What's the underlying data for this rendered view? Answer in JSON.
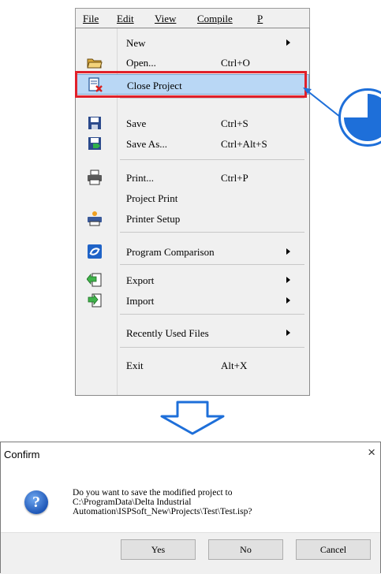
{
  "menubar": {
    "file": "File",
    "edit": "Edit",
    "view": "View",
    "compile": "Compile",
    "p": "P"
  },
  "menu": {
    "items": [
      {
        "label": "New",
        "shortcut": "",
        "submenu": true,
        "icon": ""
      },
      {
        "label": "Open...",
        "shortcut": "Ctrl+O",
        "submenu": false,
        "icon": "open-folder-icon"
      },
      {
        "label": "Close Project",
        "shortcut": "",
        "submenu": false,
        "icon": "close-project-icon"
      },
      {
        "label": "Save",
        "shortcut": "Ctrl+S",
        "submenu": false,
        "icon": "save-icon"
      },
      {
        "label": "Save As...",
        "shortcut": "Ctrl+Alt+S",
        "submenu": false,
        "icon": "save-as-icon"
      },
      {
        "label": "Print...",
        "shortcut": "Ctrl+P",
        "submenu": false,
        "icon": "print-icon"
      },
      {
        "label": "Project Print",
        "shortcut": "",
        "submenu": false,
        "icon": ""
      },
      {
        "label": "Printer Setup",
        "shortcut": "",
        "submenu": false,
        "icon": "printer-setup-icon"
      },
      {
        "label": "Program Comparison",
        "shortcut": "",
        "submenu": true,
        "icon": "compare-icon"
      },
      {
        "label": "Export",
        "shortcut": "",
        "submenu": true,
        "icon": "export-icon"
      },
      {
        "label": "Import",
        "shortcut": "",
        "submenu": true,
        "icon": "import-icon"
      },
      {
        "label": "Recently Used Files",
        "shortcut": "",
        "submenu": true,
        "icon": ""
      },
      {
        "label": "Exit",
        "shortcut": "Alt+X",
        "submenu": false,
        "icon": ""
      }
    ]
  },
  "dialog": {
    "title": "Confirm",
    "close": "×",
    "message": "Do you want to save the modified project to\nC:\\ProgramData\\Delta Industrial\nAutomation\\ISPSoft_New\\Projects\\Test\\Test.isp?",
    "yes": "Yes",
    "no": "No",
    "cancel": "Cancel"
  },
  "colors": {
    "highlight_box": "#e0202a",
    "highlight_row": "#b9d7f5",
    "callout_blue": "#1e6fd9",
    "big_arrow_blue": "#1e6fd9"
  }
}
